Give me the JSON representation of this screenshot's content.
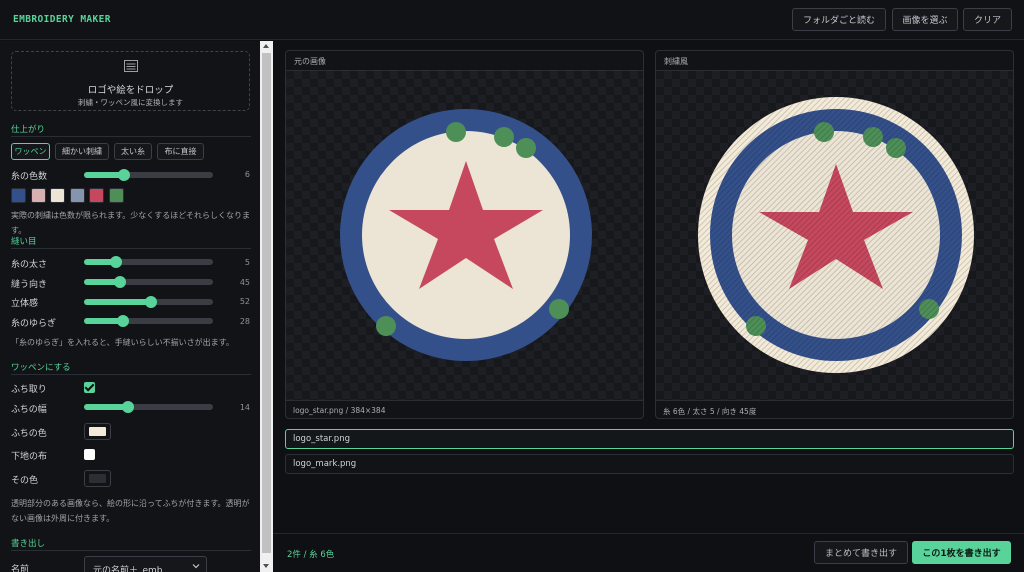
{
  "header": {
    "title": "EMBROIDERY MAKER",
    "buttons": [
      "フォルダごと読む",
      "画像を選ぶ",
      "クリア"
    ]
  },
  "sidebar": {
    "dropzone": {
      "icon": "list-icon",
      "title": "ロゴや絵をドロップ",
      "subtitle": "刺繍・ワッペン風に変換します"
    },
    "finish": {
      "title": "仕上がり",
      "chips": [
        "ワッペン",
        "細かい刺繍",
        "太い糸",
        "布に直接"
      ],
      "active_chip": "ワッペン",
      "color_count": {
        "label": "糸の色数",
        "value": "6",
        "fraction": 0.31
      },
      "palette": [
        "#34508a",
        "#d8b0b2",
        "#ece4d4",
        "#8595ae",
        "#c5485e",
        "#4e8f58"
      ],
      "note": "実際の刺繍は色数が限られます。少なくするほどそれらしくなります。"
    },
    "stitch": {
      "title": "縫い目",
      "sliders": [
        {
          "label": "糸の太さ",
          "value": "5",
          "fraction": 0.25
        },
        {
          "label": "縫う向き",
          "value": "45",
          "fraction": 0.28
        },
        {
          "label": "立体感",
          "value": "52",
          "fraction": 0.52
        },
        {
          "label": "糸のゆらぎ",
          "value": "28",
          "fraction": 0.3
        }
      ],
      "note": "「糸のゆらぎ」を入れると、手縫いらしい不揃いさが出ます。"
    },
    "patch": {
      "title": "ワッペンにする",
      "border_label": "ふち取り",
      "border_checked": true,
      "border_width": {
        "label": "ふちの幅",
        "value": "14",
        "fraction": 0.34
      },
      "border_color": {
        "label": "ふちの色",
        "color": "#f3ead8"
      },
      "base_cloth_label": "下地の布",
      "base_cloth_checked": false,
      "other_color": {
        "label": "その色",
        "color": "#2b2e33"
      },
      "note_line1": "透明部分のある画像なら、絵の形に沿ってふちが付きます。透明が",
      "note_line2": "ない画像は外周に付きます。"
    },
    "export": {
      "title": "書き出し",
      "name_label": "名前",
      "name_value": "元の名前＋_emb"
    }
  },
  "preview": {
    "original": {
      "title": "元の画像",
      "caption": "logo_star.png / 384×384"
    },
    "embroidered": {
      "title": "刺繍風",
      "caption": "糸 6色 / 太さ 5 / 向き 45度"
    }
  },
  "files": [
    "logo_star.png",
    "logo_mark.png"
  ],
  "selected_file": "logo_star.png",
  "footer": {
    "status": "2件 / 糸 6色",
    "export_all": "まとめて書き出す",
    "export_one": "この1枚を書き出す"
  },
  "colors": {
    "accent": "#58d39a",
    "star": "#c5485e",
    "ring": "#34508a",
    "cream": "#ece4d4",
    "dot": "#4e8f58"
  }
}
